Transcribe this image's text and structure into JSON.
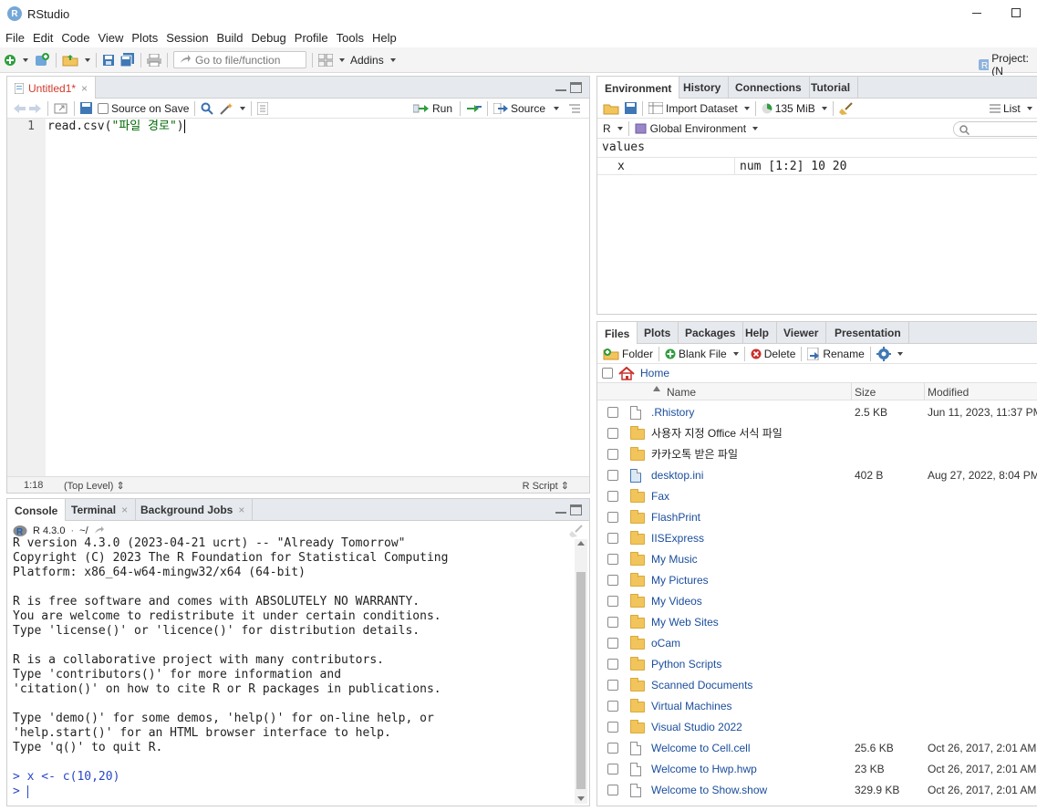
{
  "window": {
    "title": "RStudio",
    "logo_letter": "R"
  },
  "menu": [
    "File",
    "Edit",
    "Code",
    "View",
    "Plots",
    "Session",
    "Build",
    "Debug",
    "Profile",
    "Tools",
    "Help"
  ],
  "toolbar": {
    "goto_placeholder": "Go to file/function",
    "addins": "Addins",
    "project": "Project: (N"
  },
  "editor": {
    "tab": "Untitled1*",
    "source_on_save": "Source on Save",
    "run": "Run",
    "source": "Source",
    "line_number": "1",
    "code": "read.csv(\"파일 경로\")",
    "status_pos": "1:18",
    "status_scope": "(Top Level)",
    "status_type": "R Script"
  },
  "console": {
    "tabs": [
      "Console",
      "Terminal",
      "Background Jobs"
    ],
    "r_version": "R 4.3.0",
    "path": "~/",
    "lines": [
      "R version 4.3.0 (2023-04-21 ucrt) -- \"Already Tomorrow\"",
      "Copyright (C) 2023 The R Foundation for Statistical Computing",
      "Platform: x86_64-w64-mingw32/x64 (64-bit)",
      "",
      "R is free software and comes with ABSOLUTELY NO WARRANTY.",
      "You are welcome to redistribute it under certain conditions.",
      "Type 'license()' or 'licence()' for distribution details.",
      "",
      "R is a collaborative project with many contributors.",
      "Type 'contributors()' for more information and",
      "'citation()' on how to cite R or R packages in publications.",
      "",
      "Type 'demo()' for some demos, 'help()' for on-line help, or",
      "'help.start()' for an HTML browser interface to help.",
      "Type 'q()' to quit R.",
      ""
    ],
    "cmd1": "> x <- c(10,20)",
    "prompt": "> "
  },
  "environment": {
    "tabs": [
      "Environment",
      "History",
      "Connections",
      "Tutorial"
    ],
    "import_dataset": "Import Dataset",
    "memory": "135 MiB",
    "view_mode": "List",
    "lang": "R",
    "scope": "Global Environment",
    "section": "values",
    "rows": [
      {
        "name": "x",
        "value": "num [1:2] 10 20"
      }
    ]
  },
  "files": {
    "tabs": [
      "Files",
      "Plots",
      "Packages",
      "Help",
      "Viewer",
      "Presentation"
    ],
    "actions": {
      "folder": "Folder",
      "blank_file": "Blank File",
      "delete": "Delete",
      "rename": "Rename"
    },
    "breadcrumb": "Home",
    "columns": {
      "name": "Name",
      "size": "Size",
      "modified": "Modified"
    },
    "rows": [
      {
        "name": ".Rhistory",
        "icon": "history-file-icon",
        "size": "2.5 KB",
        "modified": "Jun 11, 2023, 11:37 PM"
      },
      {
        "name": "사용자 지정 Office 서식 파일",
        "icon": "folder-icon",
        "size": "",
        "modified": ""
      },
      {
        "name": "카카오톡 받은 파일",
        "icon": "folder-icon",
        "size": "",
        "modified": ""
      },
      {
        "name": "desktop.ini",
        "icon": "settings-file-icon",
        "size": "402 B",
        "modified": "Aug 27, 2022, 8:04 PM"
      },
      {
        "name": "Fax",
        "icon": "folder-icon",
        "size": "",
        "modified": ""
      },
      {
        "name": "FlashPrint",
        "icon": "folder-icon",
        "size": "",
        "modified": ""
      },
      {
        "name": "IISExpress",
        "icon": "folder-icon",
        "size": "",
        "modified": ""
      },
      {
        "name": "My Music",
        "icon": "folder-icon",
        "size": "",
        "modified": ""
      },
      {
        "name": "My Pictures",
        "icon": "folder-icon",
        "size": "",
        "modified": ""
      },
      {
        "name": "My Videos",
        "icon": "folder-icon",
        "size": "",
        "modified": ""
      },
      {
        "name": "My Web Sites",
        "icon": "folder-icon",
        "size": "",
        "modified": ""
      },
      {
        "name": "oCam",
        "icon": "folder-icon",
        "size": "",
        "modified": ""
      },
      {
        "name": "Python Scripts",
        "icon": "folder-icon",
        "size": "",
        "modified": ""
      },
      {
        "name": "Scanned Documents",
        "icon": "folder-icon",
        "size": "",
        "modified": ""
      },
      {
        "name": "Virtual Machines",
        "icon": "folder-icon",
        "size": "",
        "modified": ""
      },
      {
        "name": "Visual Studio 2022",
        "icon": "folder-icon",
        "size": "",
        "modified": ""
      },
      {
        "name": "Welcome to Cell.cell",
        "icon": "file-icon",
        "size": "25.6 KB",
        "modified": "Oct 26, 2017, 2:01 AM"
      },
      {
        "name": "Welcome to Hwp.hwp",
        "icon": "file-icon",
        "size": "23 KB",
        "modified": "Oct 26, 2017, 2:01 AM"
      },
      {
        "name": "Welcome to Show.show",
        "icon": "file-icon",
        "size": "329.9 KB",
        "modified": "Oct 26, 2017, 2:01 AM"
      }
    ]
  },
  "colors": {
    "accent": "#1a4d9c",
    "tab_bg": "#e6e9ee",
    "code_string": "#036a07",
    "console_cmd": "#2946c8"
  }
}
